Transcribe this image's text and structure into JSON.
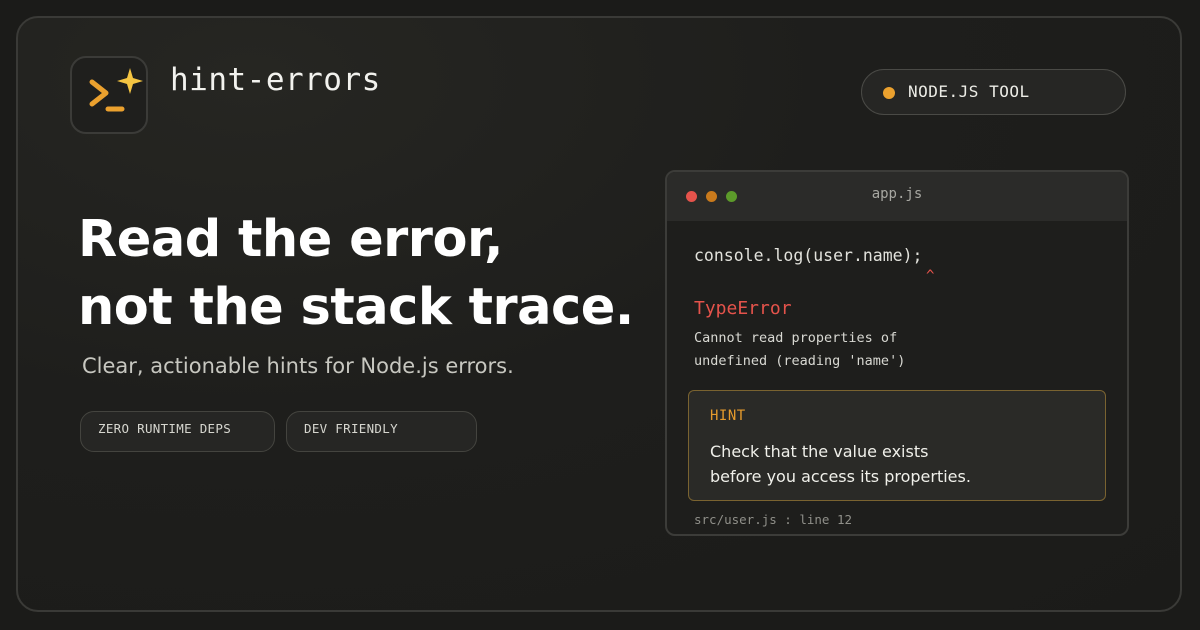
{
  "brand": {
    "name": "hint-errors",
    "logo_icon": "terminal-sparkle-icon",
    "accent": "#eba12e"
  },
  "badge": {
    "label": "NODE.JS TOOL",
    "dot_color": "#eba12e"
  },
  "hero": {
    "headline_line1": "Read the error,",
    "headline_line2": "not the stack trace.",
    "subtitle": "Clear, actionable hints for Node.js errors."
  },
  "tags": [
    "ZERO RUNTIME DEPS",
    "DEV FRIENDLY"
  ],
  "editor": {
    "filename": "app.js",
    "code": "console.log(user.name);",
    "caret": "^",
    "error_type": "TypeError",
    "error_message_line1": "Cannot read properties of",
    "error_message_line2": "undefined (reading 'name')",
    "hint": {
      "label": "HINT",
      "line1": "Check that the value exists",
      "line2": "before you access its properties."
    },
    "location": "src/user.js : line 12",
    "colors": {
      "error": "#e5534b",
      "hint": "#e59b2c"
    }
  }
}
